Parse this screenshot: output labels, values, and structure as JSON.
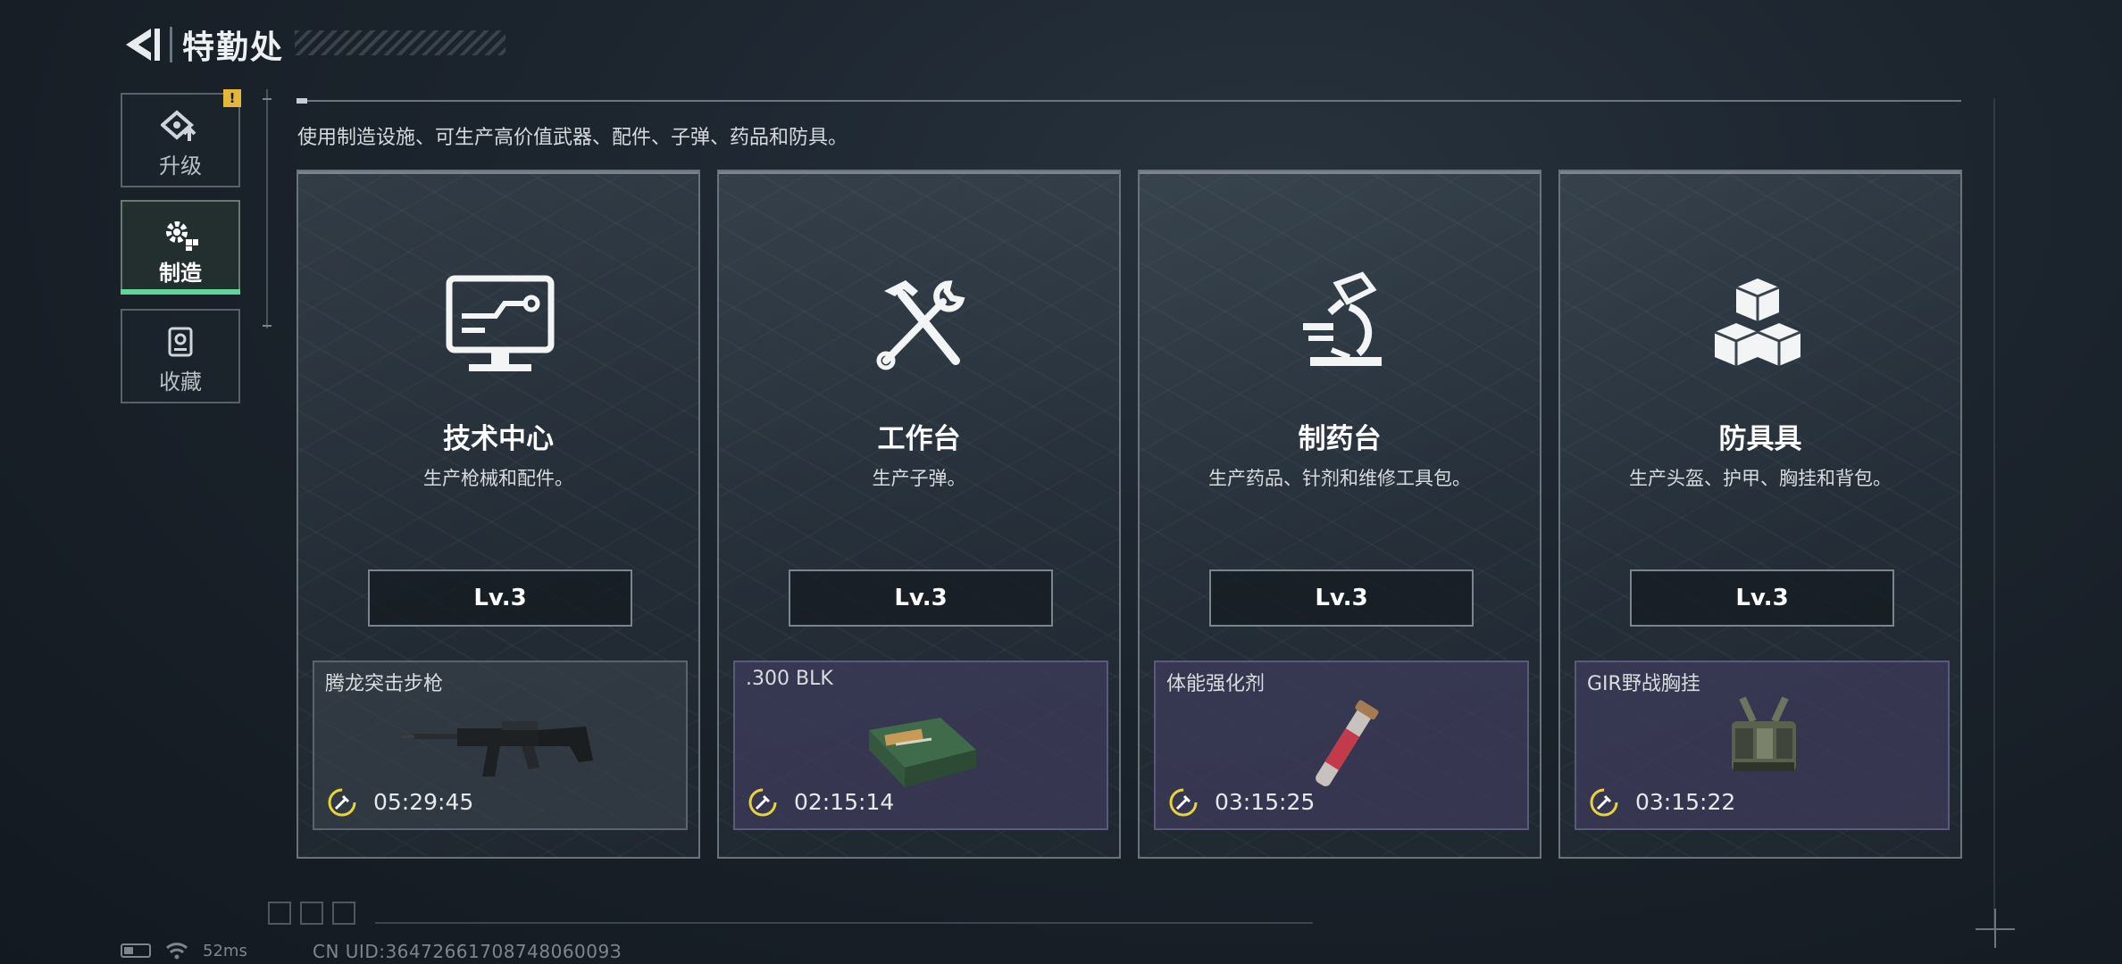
{
  "header": {
    "title": "特勤处"
  },
  "sidebar": {
    "items": [
      {
        "label": "升级",
        "icon": "upgrade-icon",
        "alert": "!"
      },
      {
        "label": "制造",
        "icon": "gear-icon",
        "active": true
      },
      {
        "label": "收藏",
        "icon": "collection-icon"
      }
    ]
  },
  "main": {
    "description": "使用制造设施、可生产高价值武器、配件、子弹、药品和防具。",
    "cards": [
      {
        "title": "技术中心",
        "subtitle": "生产枪械和配件。",
        "level": "Lv.3",
        "icon": "computer-icon",
        "crafting": {
          "item": "腾龙突击步枪",
          "time": "05:29:45",
          "item_icon": "rifle-icon"
        }
      },
      {
        "title": "工作台",
        "subtitle": "生产子弹。",
        "level": "Lv.3",
        "icon": "hammer-wrench-icon",
        "crafting": {
          "item": ".300 BLK",
          "time": "02:15:14",
          "item_icon": "ammo-box-icon"
        }
      },
      {
        "title": "制药台",
        "subtitle": "生产药品、针剂和维修工具包。",
        "level": "Lv.3",
        "icon": "microscope-icon",
        "crafting": {
          "item": "体能强化剂",
          "time": "03:15:25",
          "item_icon": "syringe-icon"
        }
      },
      {
        "title": "防具具",
        "subtitle": "生产头盔、护甲、胸挂和背包。",
        "level": "Lv.3",
        "icon": "armor-blocks-icon",
        "crafting": {
          "item": "GIR野战胸挂",
          "time": "03:15:22",
          "item_icon": "chest-rig-icon"
        }
      }
    ]
  },
  "status": {
    "ping": "52ms",
    "uid": "CN UID:3647266170874806009З"
  },
  "colors": {
    "accent": "#5fd59a",
    "alert": "#e3b83a",
    "timer": "#e8d43a",
    "slot_purple": "#3e3c5c"
  }
}
